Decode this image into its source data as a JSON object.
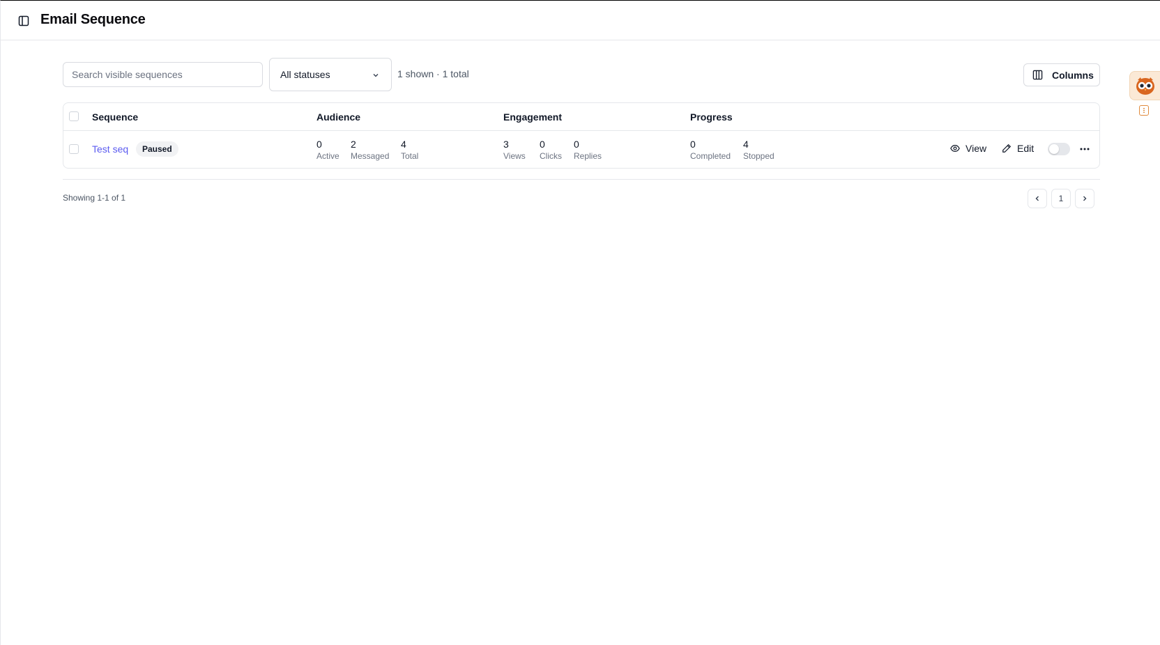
{
  "header": {
    "title": "Email Sequence",
    "sidebar_toggle_icon": "sidebar-panel-icon"
  },
  "toolbar": {
    "search_placeholder": "Search visible sequences",
    "status_filter": "All statuses",
    "count_text": "1 shown · 1 total",
    "columns_label": "Columns"
  },
  "table": {
    "headers": [
      "Sequence",
      "Audience",
      "Engagement",
      "Progress"
    ],
    "rows": [
      {
        "name": "Test seq",
        "status": "Paused",
        "audience": [
          {
            "value": "0",
            "label": "Active"
          },
          {
            "value": "2",
            "label": "Messaged"
          },
          {
            "value": "4",
            "label": "Total"
          }
        ],
        "engagement": [
          {
            "value": "3",
            "label": "Views"
          },
          {
            "value": "0",
            "label": "Clicks"
          },
          {
            "value": "0",
            "label": "Replies"
          }
        ],
        "progress": [
          {
            "value": "0",
            "label": "Completed"
          },
          {
            "value": "4",
            "label": "Stopped"
          }
        ],
        "actions": {
          "view": "View",
          "edit": "Edit"
        },
        "enabled": false
      }
    ]
  },
  "footer": {
    "showing_text": "Showing 1-1 of 1",
    "current_page": "1"
  },
  "colors": {
    "link": "#5b5bf0",
    "widget_accent": "#e08a3c"
  }
}
